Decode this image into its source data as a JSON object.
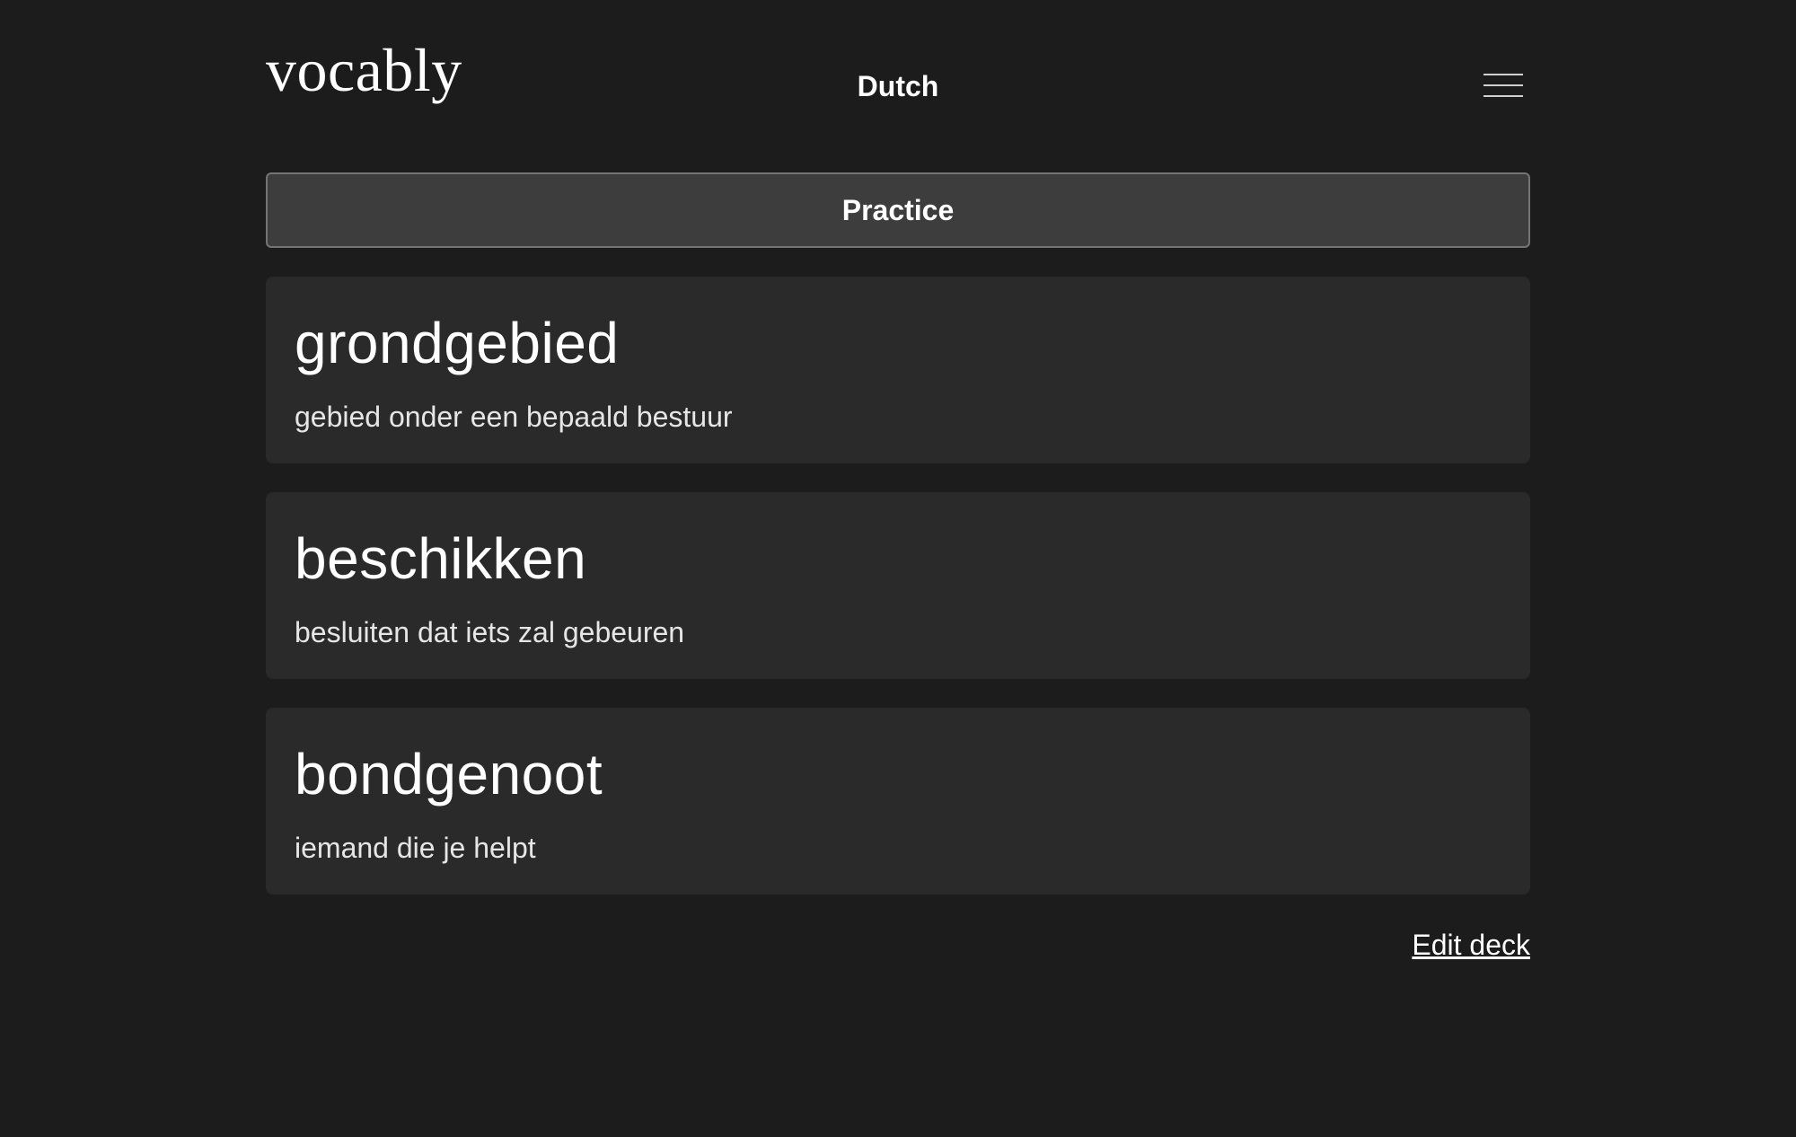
{
  "header": {
    "logo": "vocably",
    "deck_title": "Dutch",
    "menu_icon": "hamburger-menu-icon"
  },
  "practice": {
    "label": "Practice"
  },
  "cards": [
    {
      "term": "grondgebied",
      "definition": "gebied onder een bepaald bestuur"
    },
    {
      "term": "beschikken",
      "definition": "besluiten dat iets zal gebeuren"
    },
    {
      "term": "bondgenoot",
      "definition": "iemand die je helpt"
    }
  ],
  "footer": {
    "edit_label": "Edit deck"
  },
  "colors": {
    "background": "#1c1c1c",
    "card": "#2a2a2a",
    "button": "#3d3d3d",
    "button_border": "#747474",
    "text": "#ffffff"
  }
}
